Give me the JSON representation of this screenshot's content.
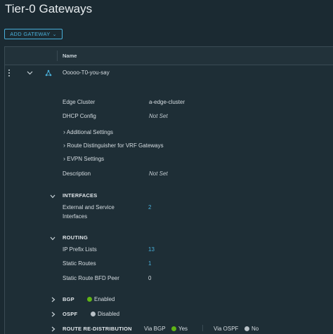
{
  "page": {
    "title": "Tier-0 Gateways",
    "add_button_label": "ADD GATEWAY",
    "add_button_chevron": "⌄"
  },
  "table": {
    "column_name": "Name"
  },
  "gateway": {
    "name": "Ooooo-T0-you-say",
    "edge_cluster_label": "Edge Cluster",
    "edge_cluster_value": "a-edge-cluster",
    "dhcp_label": "DHCP Config",
    "dhcp_value": "Not Set",
    "additional_settings": "Additional Settings",
    "route_distinguisher": "Route Distinguisher for VRF Gateways",
    "evpn_settings": "EVPN Settings",
    "description_label": "Description",
    "description_value": "Not Set"
  },
  "interfaces": {
    "heading": "INTERFACES",
    "ext_label_line1": "External and Service",
    "ext_label_line2": "Interfaces",
    "ext_count": "2"
  },
  "routing": {
    "heading": "ROUTING",
    "ip_prefix_label": "IP Prefix Lists",
    "ip_prefix_count": "13",
    "static_routes_label": "Static Routes",
    "static_routes_count": "1",
    "bfd_label": "Static Route BFD Peer",
    "bfd_count": "0"
  },
  "bgp": {
    "heading": "BGP",
    "status": "Enabled",
    "status_color": "#60b515"
  },
  "ospf": {
    "heading": "OSPF",
    "status": "Disabled",
    "status_color": "#b8c1c7"
  },
  "redistribution": {
    "heading": "ROUTE RE-DISTRIBUTION",
    "via_bgp_label": "Via BGP",
    "via_bgp_value": "Yes",
    "via_ospf_label": "Via OSPF",
    "via_ospf_value": "No"
  },
  "icons": {
    "kebab": "kebab-icon",
    "expand": "chevron-down-icon",
    "gateway": "gateway-topology-icon"
  },
  "colors": {
    "accent": "#49afd9",
    "background": "#1b2a32",
    "enabled": "#60b515"
  }
}
